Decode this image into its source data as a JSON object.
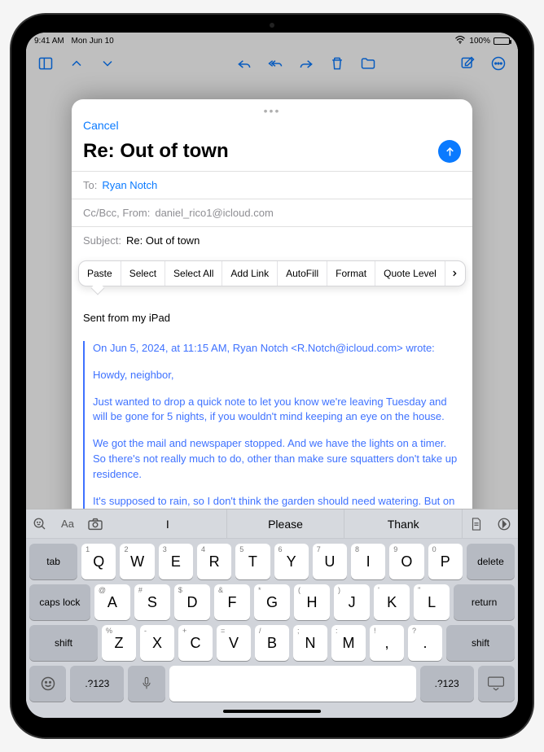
{
  "status": {
    "time": "9:41 AM",
    "date": "Mon Jun 10",
    "battery": "100%"
  },
  "compose": {
    "cancel": "Cancel",
    "title": "Re: Out of town",
    "to_label": "To:",
    "to_value": "Ryan Notch",
    "ccbcc_label": "Cc/Bcc, From:",
    "from_value": "daniel_rico1@icloud.com",
    "subject_label": "Subject:",
    "subject_value": "Re: Out of town"
  },
  "text_menu": [
    "Paste",
    "Select",
    "Select All",
    "Add Link",
    "AutoFill",
    "Format",
    "Quote Level"
  ],
  "body": {
    "signature": "Sent from my iPad",
    "quote_header": "On Jun 5, 2024, at 11:15 AM, Ryan Notch <R.Notch@icloud.com> wrote:",
    "p1": "Howdy, neighbor,",
    "p2": "Just wanted to drop a quick note to let you know we're leaving Tuesday and will be gone for 5 nights, if you wouldn't mind keeping an eye on the house.",
    "p3": "We got the mail and newspaper stopped. And we have the lights on a timer. So there's not really much to do, other than make sure squatters don't take up residence.",
    "p4": "It's supposed to rain, so I don't think the garden should need watering. But on the"
  },
  "suggestions": {
    "s1": "I",
    "s2": "Please",
    "s3": "Thank",
    "aa": "Aa"
  },
  "keys": {
    "row1": [
      "Q",
      "W",
      "E",
      "R",
      "T",
      "Y",
      "U",
      "I",
      "O",
      "P"
    ],
    "row1_hints": [
      "1",
      "2",
      "3",
      "4",
      "5",
      "6",
      "7",
      "8",
      "9",
      "0"
    ],
    "row2": [
      "A",
      "S",
      "D",
      "F",
      "G",
      "H",
      "J",
      "K",
      "L"
    ],
    "row2_hints": [
      "@",
      "#",
      "$",
      "&",
      "*",
      "(",
      ")",
      "'",
      "\""
    ],
    "row3": [
      "Z",
      "X",
      "C",
      "V",
      "B",
      "N",
      "M",
      ",",
      "."
    ],
    "row3_hints": [
      "%",
      "-",
      "+",
      "=",
      "/",
      ";",
      ":",
      "!",
      "?"
    ],
    "tab": "tab",
    "delete": "delete",
    "caps": "caps lock",
    "return": "return",
    "shift": "shift",
    "numsym": ".?123"
  }
}
